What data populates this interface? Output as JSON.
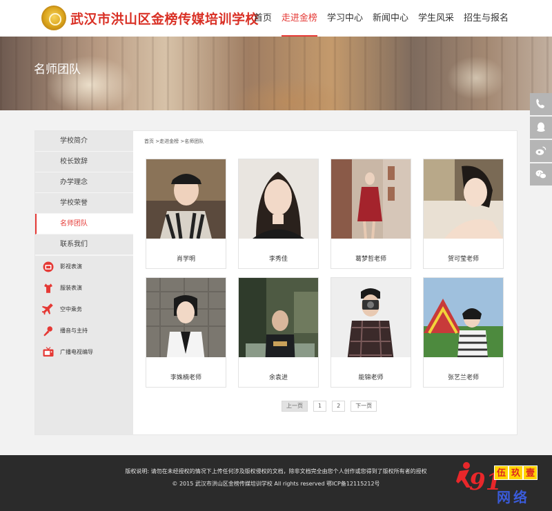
{
  "header": {
    "school_name": "武汉市洪山区金榜传媒培训学校",
    "nav": [
      "首页",
      "走进金榜",
      "学习中心",
      "新闻中心",
      "学生风采",
      "招生与报名"
    ],
    "active_nav": "走进金榜"
  },
  "banner": {
    "title": "名师团队"
  },
  "sidebar": {
    "items": [
      "学校简介",
      "校长致辞",
      "办学理念",
      "学校荣誉",
      "名师团队",
      "联系我们"
    ],
    "active": "名师团队",
    "categories": [
      {
        "label": "影视表演",
        "icon": "film-icon"
      },
      {
        "label": "服装表演",
        "icon": "dress-icon"
      },
      {
        "label": "空中乘务",
        "icon": "airplane-icon"
      },
      {
        "label": "播音与主持",
        "icon": "microphone-icon"
      },
      {
        "label": "广播电视编导",
        "icon": "tv-icon"
      }
    ]
  },
  "breadcrumb": [
    "首页",
    ">走进金榜",
    ">名师团队"
  ],
  "teachers": [
    {
      "name": "肖学明"
    },
    {
      "name": "李秀佳"
    },
    {
      "name": "葛梦哲老师"
    },
    {
      "name": "贺可莹老师"
    },
    {
      "name": "李姝楠老师"
    },
    {
      "name": "余袁进"
    },
    {
      "name": "能锦老师"
    },
    {
      "name": "张艺兰老师"
    }
  ],
  "pager": {
    "prev": "上一页",
    "pages": [
      "1",
      "2"
    ],
    "next": "下一页"
  },
  "footer": {
    "copyright_notice": "版权说明: 请勿在未经授权的情况下上传任何涉及版权侵权的文档，除非文档完全由您个人创作或您得到了版权所有者的授权",
    "copyright_line": "© 2015 武汉市洪山区金榜传媒培训学校 All rights reserved 鄂ICP备12115212号"
  },
  "watermark": {
    "number": "91",
    "brand_chars": [
      "伍",
      "玖",
      "壹"
    ],
    "text": "网络"
  },
  "float_bar": [
    "phone-icon",
    "qq-icon",
    "weibo-icon",
    "wechat-icon"
  ],
  "colors": {
    "accent": "#e53935",
    "footer_bg": "#2b2b2b",
    "sidebar_bg": "#e8e8e8"
  }
}
